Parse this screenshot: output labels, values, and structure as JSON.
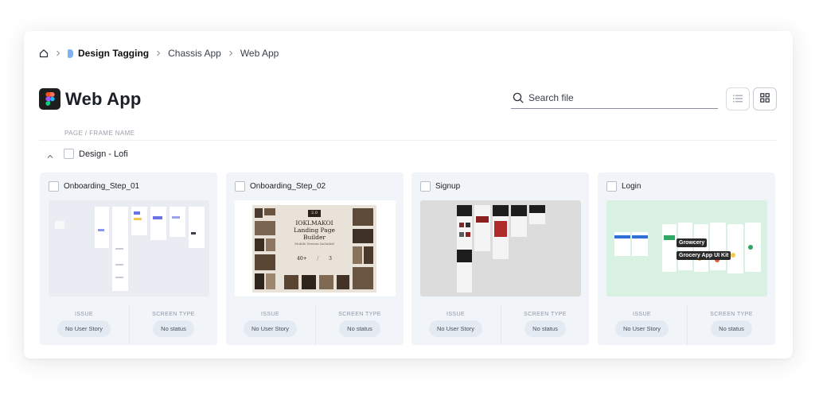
{
  "breadcrumb": {
    "items": [
      "Design Tagging",
      "Chassis App",
      "Web App"
    ]
  },
  "header": {
    "title": "Web App"
  },
  "search": {
    "placeholder": "Search file"
  },
  "list": {
    "column_header": "PAGE / FRAME NAME",
    "group_label": "Design - Lofi"
  },
  "cards": [
    {
      "title": "Onboarding_Step_01",
      "issue_label": "ISSUE",
      "issue_value": "No User Story",
      "type_label": "SCREEN TYPE",
      "type_value": "No status"
    },
    {
      "title": "Onboarding_Step_02",
      "issue_label": "ISSUE",
      "issue_value": "No User Story",
      "type_label": "SCREEN TYPE",
      "type_value": "No status"
    },
    {
      "title": "Signup",
      "issue_label": "ISSUE",
      "issue_value": "No User Story",
      "type_label": "SCREEN TYPE",
      "type_value": "No status"
    },
    {
      "title": "Login",
      "issue_label": "ISSUE",
      "issue_value": "No User Story",
      "type_label": "SCREEN TYPE",
      "type_value": "No status"
    }
  ],
  "thumbnails": {
    "landing": {
      "badge": "2.0",
      "line1": "IOKLMAKOI",
      "line2": "Landing Page",
      "line3": "Builder",
      "line4": "Mobile Version Included",
      "stat1": "40+",
      "stat2": "3"
    },
    "grocery": {
      "tag1": "Growcery",
      "tag2": "Grocery App UI Kit"
    }
  },
  "colors": {
    "accent_file": "#7fb2f2",
    "card_bg": "#f1f5fa",
    "pill_bg": "#e4eaf2",
    "thumb_login_bg": "#d8f1e2"
  }
}
